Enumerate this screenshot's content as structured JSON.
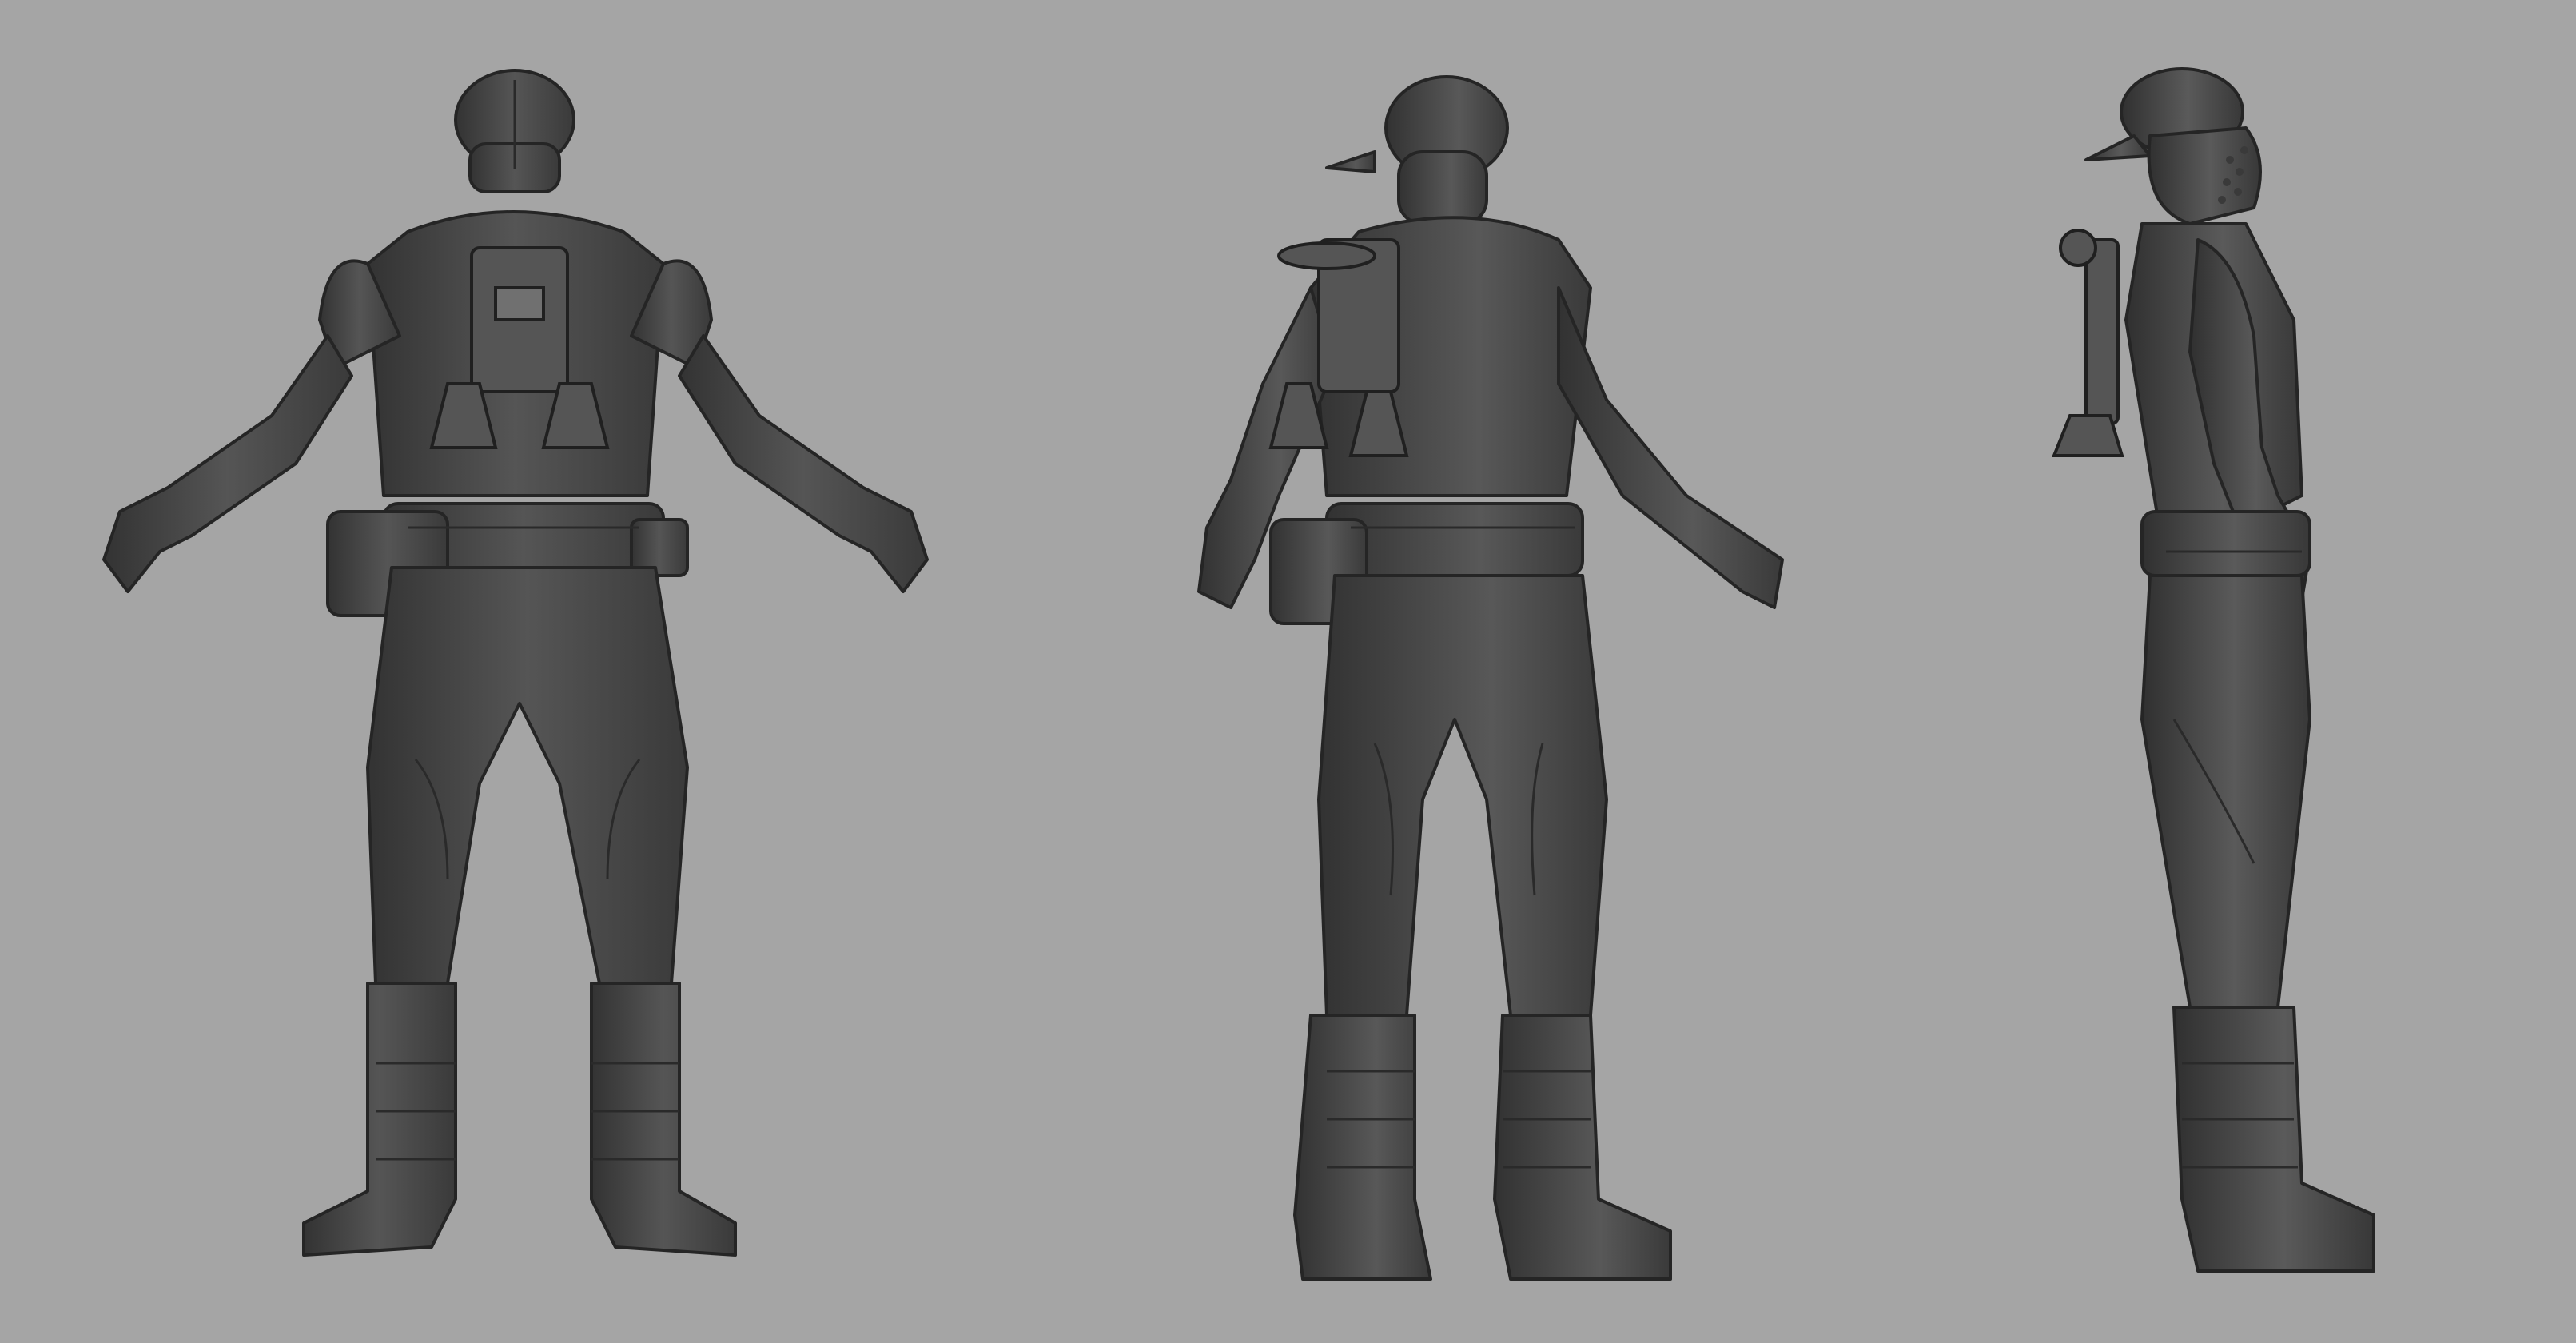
{
  "scene": {
    "background_color": "#a5a5a5",
    "model_color": "#4a4a4a",
    "model_shadow_color": "#2e2e2e",
    "model_highlight_color": "#6a6a6a",
    "views": [
      {
        "id": "back",
        "icon": "soldier-back-view"
      },
      {
        "id": "three-quarter",
        "icon": "soldier-three-quarter-back-view"
      },
      {
        "id": "side",
        "icon": "soldier-side-view"
      }
    ]
  }
}
